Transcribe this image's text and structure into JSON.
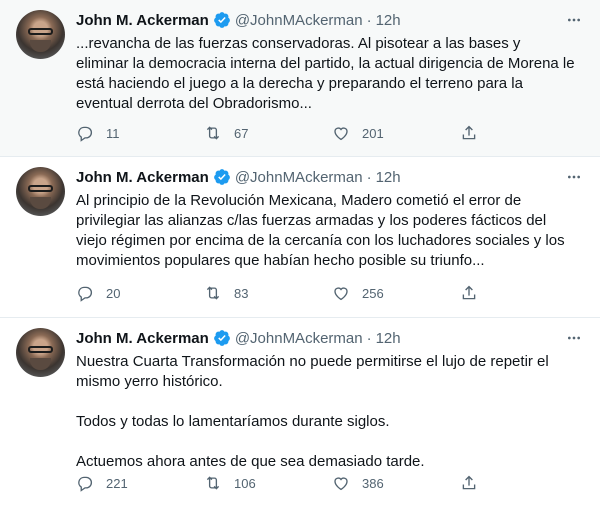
{
  "colors": {
    "verified": "#1d9bf0",
    "text_primary": "#0f1419",
    "text_secondary": "#536471",
    "highlight_bg": "#f7f9f9",
    "divider": "#e6ecf0"
  },
  "icons": [
    "verified-badge-icon",
    "more-icon",
    "reply-icon",
    "retweet-icon",
    "like-icon",
    "share-icon"
  ],
  "tweets": [
    {
      "author": "John M. Ackerman",
      "handle": "@JohnMAckerman",
      "separator": "·",
      "time": "12h",
      "paragraphs": [
        "...revancha de las fuerzas conservadoras. Al pisotear a las bases y eliminar la democracia interna del partido, la actual dirigencia de Morena le está haciendo el juego a la derecha y preparando el terreno para la eventual derrota del Obradorismo..."
      ],
      "replies": "11",
      "retweets": "67",
      "likes": "201"
    },
    {
      "author": "John M. Ackerman",
      "handle": "@JohnMAckerman",
      "separator": "·",
      "time": "12h",
      "paragraphs": [
        "Al principio de la Revolución Mexicana, Madero cometió el error de privilegiar las alianzas c/las fuerzas armadas y los poderes fácticos del viejo régimen por encima de la cercanía con los luchadores sociales y los movimientos populares que habían hecho posible su triunfo..."
      ],
      "replies": "20",
      "retweets": "83",
      "likes": "256"
    },
    {
      "author": "John M. Ackerman",
      "handle": "@JohnMAckerman",
      "separator": "·",
      "time": "12h",
      "paragraphs": [
        "Nuestra Cuarta Transformación no puede permitirse el lujo de repetir el mismo yerro histórico.",
        "Todos y todas lo lamentaríamos durante siglos.",
        "Actuemos ahora antes de que sea demasiado tarde."
      ],
      "replies": "221",
      "retweets": "106",
      "likes": "386"
    }
  ]
}
